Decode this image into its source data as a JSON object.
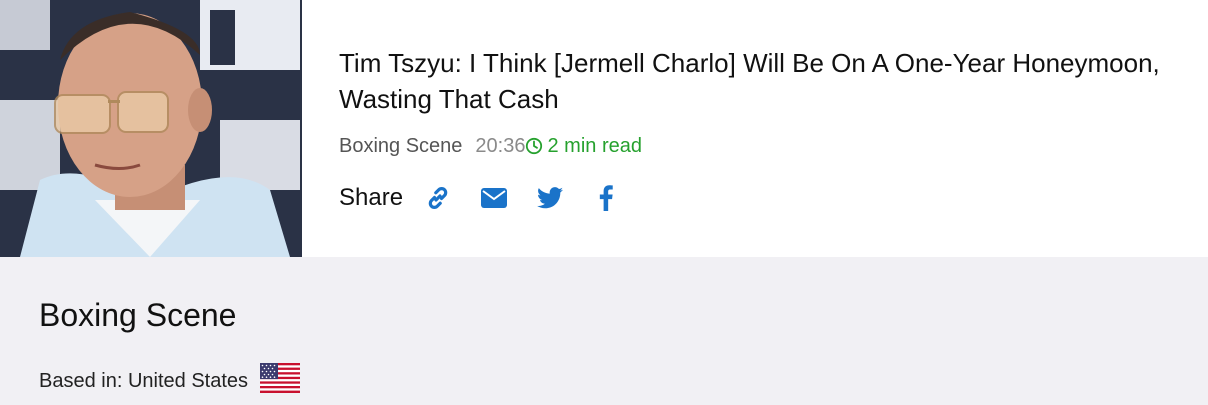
{
  "article": {
    "title": "Tim Tszyu: I Think [Jermell Charlo] Will Be On A One-Year Honeymoon, Wasting That Cash",
    "source": "Boxing Scene",
    "time": "20:36",
    "read_time": "2 min read",
    "image_alt": "Tim Tszyu photo",
    "share": {
      "label": "Share",
      "buttons": [
        "link-icon",
        "email-icon",
        "twitter-icon",
        "facebook-icon"
      ]
    }
  },
  "source_card": {
    "name": "Boxing Scene",
    "based_in": "Based in: United States",
    "flag": "us-flag"
  },
  "colors": {
    "accent_blue": "#1a73c9",
    "read_green": "#26a12e",
    "card_bg": "#f1f0f4"
  }
}
